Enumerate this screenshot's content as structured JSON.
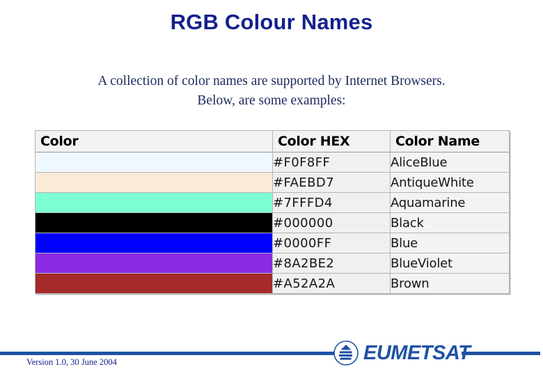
{
  "slide": {
    "title": "RGB Colour Names",
    "intro_line_1": "A collection of color names are supported by Internet Browsers.",
    "intro_line_2": "Below, are some examples:",
    "title_color": "#14218C",
    "text_color": "#1D2A5E"
  },
  "table": {
    "headers": [
      "Color",
      "Color HEX",
      "Color Name"
    ],
    "rows": [
      {
        "swatch": "#F0F8FF",
        "hex": "#F0F8FF",
        "name": "AliceBlue"
      },
      {
        "swatch": "#FAEBD7",
        "hex": "#FAEBD7",
        "name": "AntiqueWhite"
      },
      {
        "swatch": "#7FFFD4",
        "hex": "#7FFFD4",
        "name": "Aquamarine"
      },
      {
        "swatch": "#000000",
        "hex": "#000000",
        "name": "Black"
      },
      {
        "swatch": "#0000FF",
        "hex": "#0000FF",
        "name": "Blue"
      },
      {
        "swatch": "#8A2BE2",
        "hex": "#8A2BE2",
        "name": "BlueViolet"
      },
      {
        "swatch": "#A52A2A",
        "hex": "#A52A2A",
        "name": "Brown"
      }
    ]
  },
  "footer": {
    "version": "Version 1.0, 30 June 2004",
    "logo_text": "EUMETSAT",
    "accent_color": "#1F52A5"
  }
}
